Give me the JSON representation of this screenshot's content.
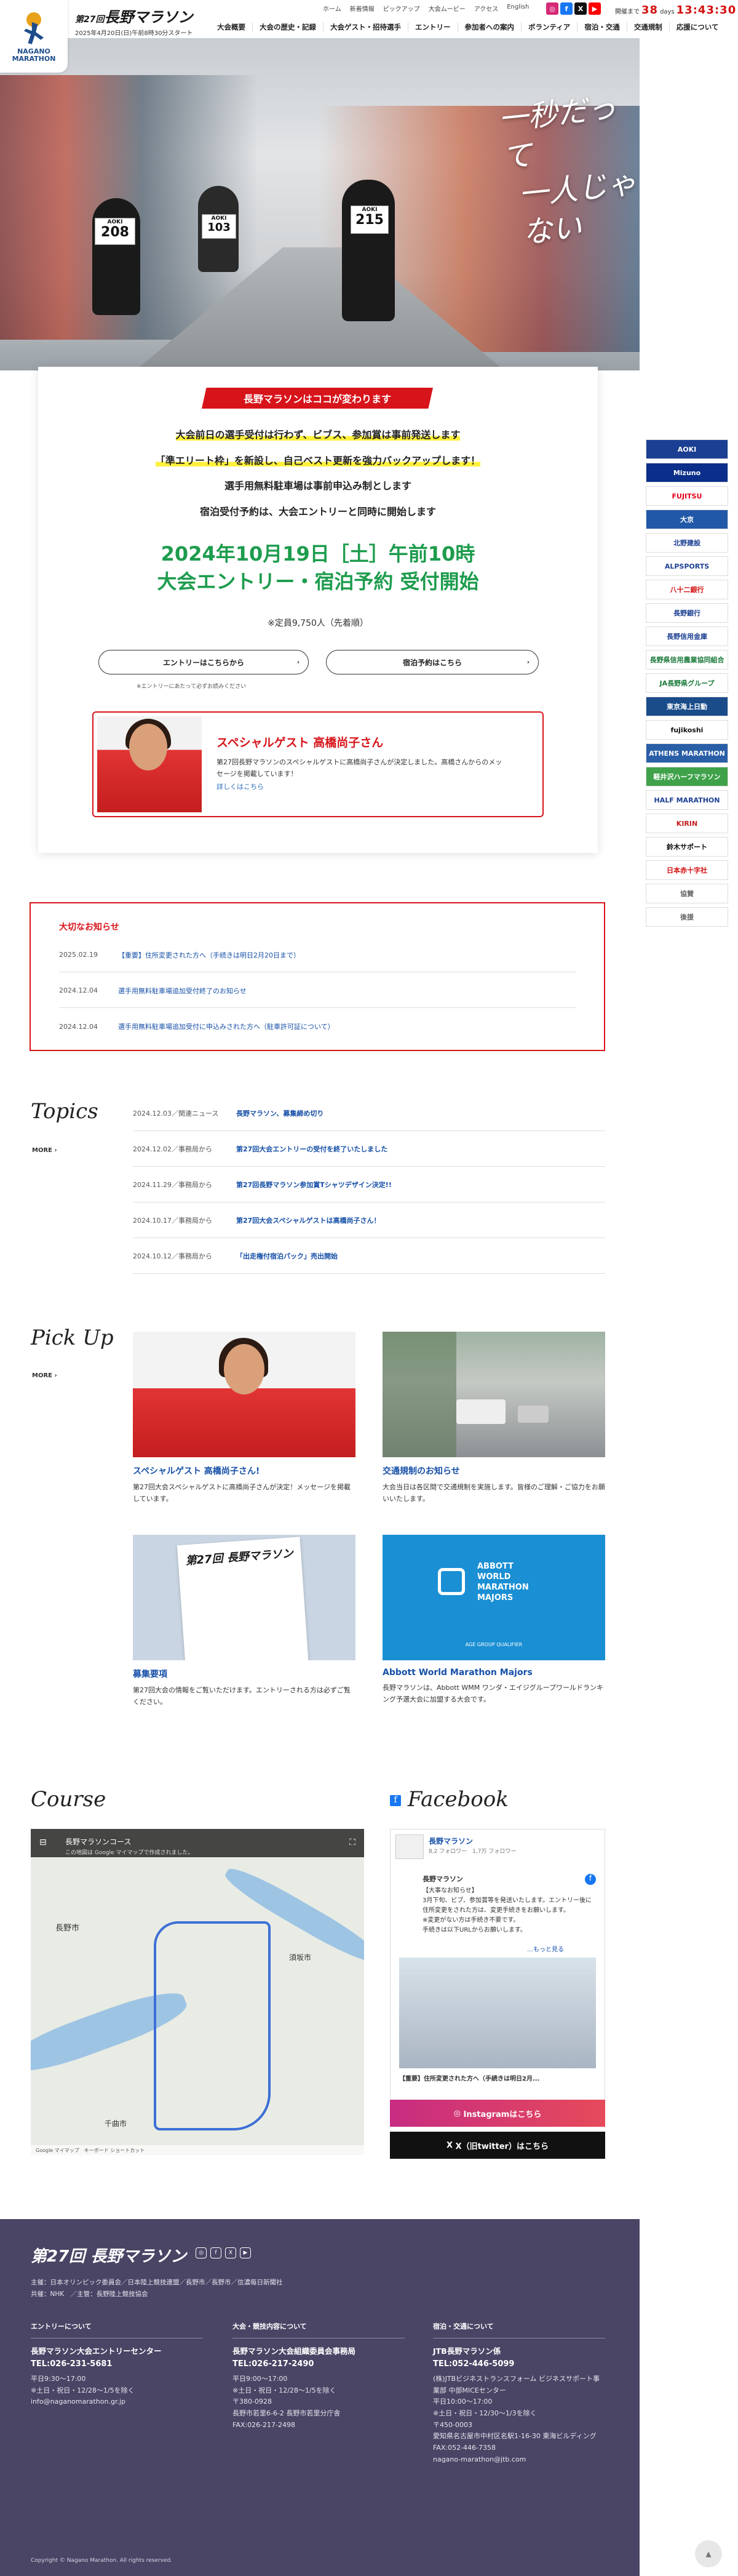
{
  "header": {
    "logo_text": "NAGANO\nMARATHON",
    "edition": "第27回",
    "title": "長野マラソン",
    "subtitle": "2025年4月20日(日)午前8時30分スタート",
    "subnav": [
      "ホーム",
      "新着情報",
      "ピックアップ",
      "大会ムービー",
      "アクセス",
      "English"
    ],
    "socials": [
      {
        "icon": "instagram-icon",
        "glyph": "◎",
        "color": "#d62976"
      },
      {
        "icon": "facebook-icon",
        "glyph": "f",
        "color": "#1877f2"
      },
      {
        "icon": "x-icon",
        "glyph": "X",
        "color": "#111111"
      },
      {
        "icon": "youtube-icon",
        "glyph": "▶",
        "color": "#ff0000"
      }
    ],
    "countdown_label": "開催まで",
    "countdown_value": "38",
    "countdown_unit": "days",
    "countdown_time": "13:43:30",
    "mainnav": [
      "大会概要",
      "大会の歴史・記録",
      "大会ゲスト・招待選手",
      "エントリー",
      "参加者への案内",
      "ボランティア",
      "宿泊・交通",
      "交通規制",
      "応援について"
    ]
  },
  "hero": {
    "catch_line1": "一秒だって",
    "catch_line2": "一人じゃない",
    "bibs": [
      {
        "label": "208",
        "top": "AOKI"
      },
      {
        "label": "103",
        "top": "AOKI"
      },
      {
        "label": "215",
        "top": "AOKI"
      }
    ]
  },
  "card": {
    "tag": "長野マラソンはココが変わります",
    "lines": [
      "大会前日の選手受付は行わず、ビブス、参加賞は事前発送します",
      "「準エリート枠」を新設し、自己ベスト更新を強力バックアップします！",
      "選手用無料駐車場は事前申込み制とします",
      "宿泊受付予約は、大会エントリーと同時に開始します"
    ],
    "date_line1": "2024年10月19日［土］午前10時",
    "date_line2": "大会エントリー・宿泊予約 受付開始",
    "capacity": "※定員9,750人（先着順）",
    "entry_button": "エントリーはこちらから",
    "hotel_button": "宿泊予約はこちら",
    "entry_note": "※エントリーにあたって必ずお読みください",
    "guest_title": "スペシャルゲスト 高橋尚子さん",
    "guest_desc": "第27回長野マラソンのスペシャルゲストに高橋尚子さんが決定しました。高橋さんからのメッセージを掲載しています！",
    "guest_link": "詳しくはこちら"
  },
  "sponsors": [
    {
      "name": "AOKI",
      "color": "#ffffff",
      "bg": "#1b3f93"
    },
    {
      "name": "Mizuno",
      "color": "#ffffff",
      "bg": "#0a2e8a"
    },
    {
      "name": "FUJITSU",
      "color": "#e2001a",
      "bg": "#ffffff"
    },
    {
      "name": "大京",
      "color": "#ffffff",
      "bg": "#2159a8"
    },
    {
      "name": "北野建設",
      "color": "#1b3f93",
      "bg": "#ffffff"
    },
    {
      "name": "ALPSPORTS",
      "color": "#1b3f93",
      "bg": "#ffffff"
    },
    {
      "name": "八十二銀行",
      "color": "#d40f0f",
      "bg": "#ffffff"
    },
    {
      "name": "長野銀行",
      "color": "#1b3f93",
      "bg": "#ffffff"
    },
    {
      "name": "長野信用金庫",
      "color": "#1b3f93",
      "bg": "#ffffff"
    },
    {
      "name": "長野県信用農業協同組合",
      "color": "#1a7a3a",
      "bg": "#ffffff"
    },
    {
      "name": "JA長野県グループ",
      "color": "#1a7a3a",
      "bg": "#ffffff"
    },
    {
      "name": "東京海上日動",
      "color": "#ffffff",
      "bg": "#1a4c8a"
    },
    {
      "name": "fujikoshi",
      "color": "#111111",
      "bg": "#ffffff"
    },
    {
      "name": "ATHENS MARATHON",
      "color": "#ffffff",
      "bg": "#2a5fa8"
    },
    {
      "name": "軽井沢ハーフマラソン",
      "color": "#ffffff",
      "bg": "#3fa24a"
    },
    {
      "name": "HALF MARATHON",
      "color": "#1b3f93",
      "bg": "#ffffff"
    },
    {
      "name": "KIRIN",
      "color": "#c41e1e",
      "bg": "#ffffff"
    },
    {
      "name": "鈴木サポート",
      "color": "#111111",
      "bg": "#ffffff"
    },
    {
      "name": "日本赤十字社",
      "color": "#d40f0f",
      "bg": "#ffffff"
    },
    {
      "name": "協賛",
      "color": "#666666",
      "bg": "#ffffff"
    },
    {
      "name": "後援",
      "color": "#666666",
      "bg": "#ffffff"
    }
  ],
  "notice": {
    "heading": "大切なお知らせ",
    "items": [
      {
        "date": "2025.02.19",
        "text": "【重要】住所変更された方へ（手続きは明日2月20日まで）"
      },
      {
        "date": "2024.12.04",
        "text": "選手用無料駐車場追加受付終了のお知らせ"
      },
      {
        "date": "2024.12.04",
        "text": "選手用無料駐車場追加受付に申込みされた方へ（駐車許可証について）"
      }
    ]
  },
  "topics": {
    "heading": "Topics",
    "more": "MORE ›",
    "items": [
      {
        "meta": "2024.12.03／関連ニュース",
        "text": "長野マラソン、募集締め切り"
      },
      {
        "meta": "2024.12.02／事務局から",
        "text": "第27回大会エントリーの受付を終了いたしました"
      },
      {
        "meta": "2024.11.29／事務局から",
        "text": "第27回長野マラソン参加賞Tシャツデザイン決定!!"
      },
      {
        "meta": "2024.10.17／事務局から",
        "text": "第27回大会スペシャルゲストは高橋尚子さん！"
      },
      {
        "meta": "2024.10.12／事務局から",
        "text": "「出走権付宿泊パック」売出開始"
      }
    ]
  },
  "pickup": {
    "heading": "Pick Up",
    "more": "MORE ›",
    "items": [
      {
        "title": "スペシャルゲスト 高橋尚子さん!",
        "desc": "第27回大会スペシャルゲストに高橋尚子さんが決定！メッセージを掲載しています。"
      },
      {
        "title": "交通規制のお知らせ",
        "desc": "大会当日は各区間で交通規制を実施します。皆様のご理解・ご協力をお願いいたします。"
      },
      {
        "title": "募集要項",
        "desc": "第27回大会の情報をご覧いただけます。エントリーされる方は必ずご覧ください。"
      },
      {
        "title": "Abbott World Marathon Majors",
        "desc": "長野マラソンは、Abbott WMM ワンダ・エイジグループワールドランキング予選大会に加盟する大会です。"
      }
    ],
    "flyer_title": "第27回 長野マラソン",
    "abbott_lines": [
      "ABBOTT",
      "WORLD",
      "MARATHON",
      "MAJORS"
    ],
    "abbott_sub": "AGE GROUP QUALIFIER"
  },
  "course": {
    "heading": "Course",
    "map_title": "長野マラソンコース",
    "map_sub": "この地図は Google マイマップで作成されました。",
    "map_footer": "Google マイマップ　キーボード ショートカット",
    "place_labels": [
      "長野市",
      "須坂市",
      "千曲市"
    ]
  },
  "facebook": {
    "heading": "Facebook",
    "page_name": "長野マラソン",
    "followers": "8,2 フォロワー　1,7万 フォロワー",
    "post_name": "長野マラソン",
    "post_text": "【大事なお知らせ】\n3月下旬、ビブ、参加賞等を発送いたします。エントリー後に住所変更をされた方は、変更手続きをお願いします。\n※変更がない方は手続き不要です。\n手続きは以下URLからお願いします。",
    "post_more": "…もっと見る",
    "link_caption": "【重要】住所変更された方へ（手続きは明日2月...",
    "instagram_button": "Instagramはこちら",
    "twitter_button": "X（旧twitter）はこちら"
  },
  "footer": {
    "brand": "第27回 長野マラソン",
    "org_lines": [
      "主催：日本オリンピック委員会／日本陸上競技連盟／長野市／長野市／信濃毎日新聞社",
      "共催：NHK　／主管：長野陸上競技協会"
    ],
    "cols": [
      {
        "h": "エントリーについて",
        "name": "長野マラソン大会エントリーセンター",
        "tel": "TEL:026-231-5681",
        "lines": [
          "平日9:30〜17:00",
          "※土日・祝日・12/28〜1/5を除く",
          "info@naganomarathon.gr.jp"
        ]
      },
      {
        "h": "大会・競技内容について",
        "name": "長野マラソン大会組織委員会事務局",
        "tel": "TEL:026-217-2490",
        "lines": [
          "平日9:00〜17:00",
          "※土日・祝日・12/28〜1/5を除く",
          "〒380-0928",
          "長野市若里6-6-2 長野市若里分庁舎",
          "FAX:026-217-2498"
        ]
      },
      {
        "h": "宿泊・交通について",
        "name": "JTB長野マラソン係",
        "tel": "TEL:052-446-5099",
        "lines": [
          "(株)JTBビジネストランスフォーム ビジネスサポート事業部 中部MICEセンター",
          "平日10:00〜17:00",
          "※土日・祝日・12/30〜1/3を除く",
          "〒450-0003",
          "愛知県名古屋市中村区名駅1-16-30 東海ビルディング",
          "FAX:052-446-7358",
          "nagano-marathon@jtb.com"
        ]
      }
    ],
    "copyright": "Copyright © Nagano Marathon. All rights reserved."
  }
}
